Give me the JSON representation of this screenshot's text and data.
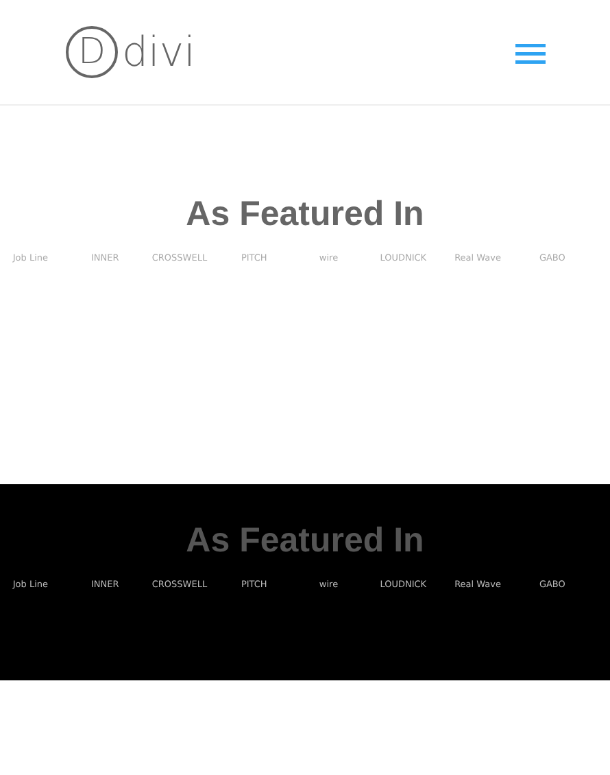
{
  "header": {
    "logo_mark": "D",
    "logo_text": "divi"
  },
  "sections": [
    {
      "kind": "light",
      "title": "As Featured In",
      "logos": [
        "Job Line",
        "INNER",
        "CROSSWELL",
        "PITCH",
        "wire",
        "LOUDNICK",
        "Real Wave",
        "GABO"
      ]
    },
    {
      "kind": "dark",
      "title": "As Featured In",
      "logos": [
        "Job Line",
        "INNER",
        "CROSSWELL",
        "PITCH",
        "wire",
        "LOUDNICK",
        "Real Wave",
        "GABO"
      ]
    }
  ]
}
